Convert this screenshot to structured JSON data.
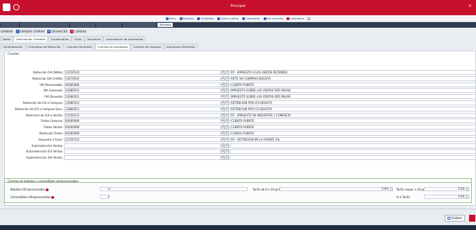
{
  "window": {
    "title": "Principal"
  },
  "quickbar": {
    "items": [
      {
        "icon": "home-icon",
        "label": "Inicio",
        "color": "#2f66b8"
      },
      {
        "icon": "modules-icon",
        "label": "Módulos",
        "color": "#2f66b8"
      },
      {
        "icon": "folder-icon",
        "label": "Utilidades",
        "color": "#2f66b8"
      },
      {
        "icon": "globe-icon",
        "label": "Sudo cuadros",
        "color": "#2f66b8"
      },
      {
        "icon": "calendar-icon",
        "label": "Calendario",
        "color": "#2f66b8"
      },
      {
        "icon": "mail-icon",
        "label": "Mis archivos",
        "color": "#2f66b8"
      },
      {
        "icon": "flag-icon",
        "label": "Calendario",
        "color": "#c8102e"
      }
    ]
  },
  "doc_tabs": [
    "",
    "",
    "",
    "",
    "Tercceros"
  ],
  "actions": [
    {
      "label": "GRABAR"
    },
    {
      "label": "GRABAR CERRAR"
    },
    {
      "label": "DESHACER"
    },
    {
      "label": "CERRAR"
    }
  ],
  "tabs": [
    "Datos",
    "Información Contable",
    "Consecutivos",
    "Otros",
    "Interfaces",
    "Autorización de Inventarios"
  ],
  "subtabs": [
    "Comprobantes",
    "Conceptos de Retención",
    "Cuentas Generales",
    "Cuentas de Impuestos",
    "Cuentas de Ingresos",
    "Impuestos Distritales"
  ],
  "panel_legend": "Cuentas",
  "rows": [
    {
      "label": "Retención IVA Débito",
      "code": "53150520",
      "desc": "RF - IMPUESTO A LAS VENTAS RETENIDO"
    },
    {
      "label": "Retención IVA Crédito",
      "code": "23670505",
      "desc": "RETE IVA COMPRAS BOGOTA"
    },
    {
      "label": "IVA Descontable",
      "code": "84060089",
      "desc": "CUENTA PUENTE"
    },
    {
      "label": "IVA Generado",
      "code": "24080501",
      "desc": "IMPUESTO SOBRE LAS VENTAS POR PAGAR"
    },
    {
      "label": "IVA Devuelto",
      "code": "24080501",
      "desc": "IMPUESTO SOBRE LAS VENTAS POR PAGAR"
    },
    {
      "label": "Retención de ICA a Compras",
      "code": "23680501",
      "desc": "RETENCION POR ICA BOGOTA"
    },
    {
      "label": "Retención de ICA a Compras Serv.",
      "code": "23680501",
      "desc": "RETENCION POR ICA BOGOTA"
    },
    {
      "label": "Retención de ICA a Ventas",
      "code": "53150510",
      "desc": "RF - IMPUESTO DE INDUSTRIA Y COMERCIO"
    },
    {
      "label": "Fletes Compras",
      "code": "84060089",
      "desc": "CUENTA PUENTE"
    },
    {
      "label": "Fletes Ventas",
      "code": "84060089",
      "desc": "CUENTA PUENTE"
    },
    {
      "label": "Retención Fletes",
      "code": "84060089",
      "desc": "CUENTA PUENTE"
    },
    {
      "label": "Impuesto a Favor",
      "code": "53150510",
      "desc": "RF - RETENCION EN LA FUENTE 2%"
    },
    {
      "label": "Autorretención Ventas",
      "code": "",
      "desc": ""
    },
    {
      "label": "Autorretención ICA Ventas",
      "code": "",
      "desc": ""
    },
    {
      "label": "Autorretención IVA Ventas",
      "code": "",
      "desc": ""
    }
  ],
  "group": {
    "legend": "Cuentas de bebidas y comestibles ultraprocesados",
    "left_fields": [
      {
        "label": "Bebidas Ultraprocesadas"
      },
      {
        "label": "Comestibles Ultraprocesados"
      }
    ],
    "right_fields": [
      {
        "label": "Tarifa de 6 a 10 gr/ml",
        "value": "0.00"
      },
      {
        "label": "Tarifa mayor a 10 gr/ml",
        "value": "0.00"
      },
      {
        "label": "% a Tarifa",
        "value": "0.00"
      }
    ]
  },
  "footer": {
    "save_label": "Grabar"
  },
  "colors": {
    "brand": "#c8102e",
    "link": "#2f66b8"
  }
}
